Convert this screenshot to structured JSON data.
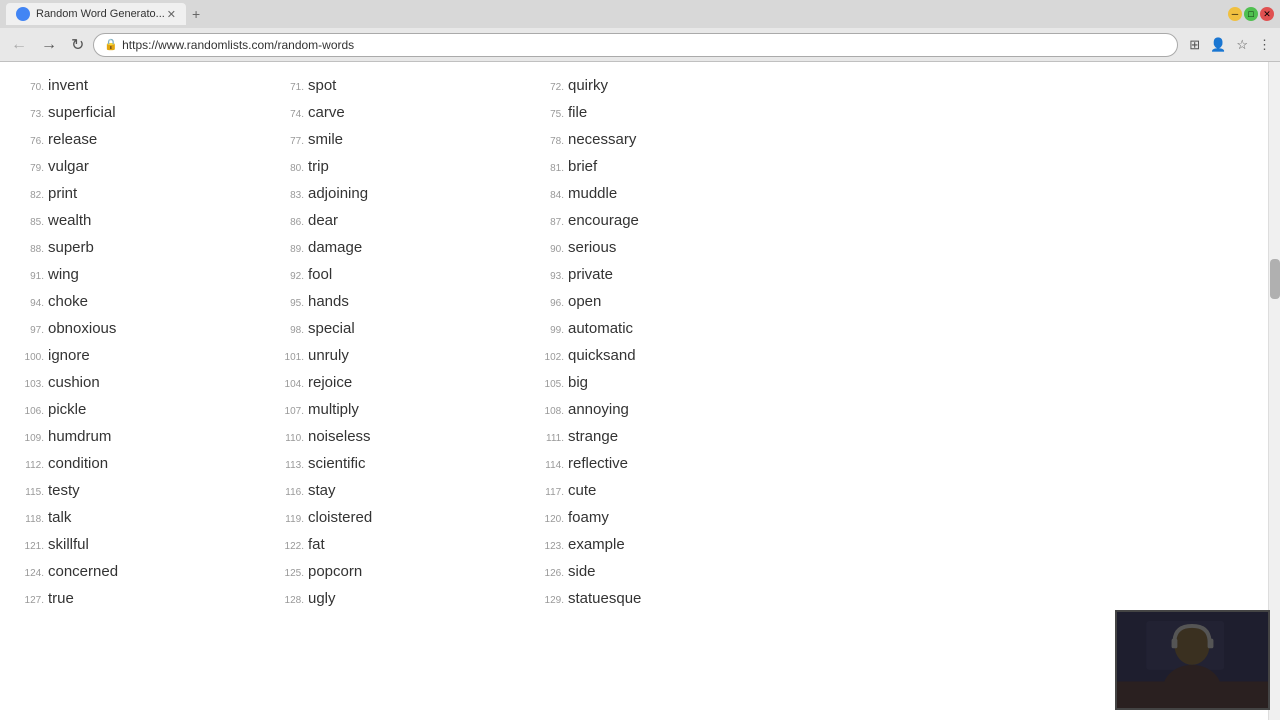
{
  "browser": {
    "tab_title": "Random Word Generato...",
    "url": "https://www.randomlists.com/random-words",
    "favicon": "🔀"
  },
  "words": [
    {
      "num": "70.",
      "word": "invent"
    },
    {
      "num": "71.",
      "word": "spot"
    },
    {
      "num": "72.",
      "word": "quirky"
    },
    {
      "num": "73.",
      "word": "superficial"
    },
    {
      "num": "74.",
      "word": "carve"
    },
    {
      "num": "75.",
      "word": "file"
    },
    {
      "num": "76.",
      "word": "release"
    },
    {
      "num": "77.",
      "word": "smile"
    },
    {
      "num": "78.",
      "word": "necessary"
    },
    {
      "num": "79.",
      "word": "vulgar"
    },
    {
      "num": "80.",
      "word": "trip"
    },
    {
      "num": "81.",
      "word": "brief"
    },
    {
      "num": "82.",
      "word": "print"
    },
    {
      "num": "83.",
      "word": "adjoining"
    },
    {
      "num": "84.",
      "word": "muddle"
    },
    {
      "num": "85.",
      "word": "wealth"
    },
    {
      "num": "86.",
      "word": "dear"
    },
    {
      "num": "87.",
      "word": "encourage"
    },
    {
      "num": "88.",
      "word": "superb"
    },
    {
      "num": "89.",
      "word": "damage"
    },
    {
      "num": "90.",
      "word": "serious"
    },
    {
      "num": "91.",
      "word": "wing"
    },
    {
      "num": "92.",
      "word": "fool"
    },
    {
      "num": "93.",
      "word": "private"
    },
    {
      "num": "94.",
      "word": "choke"
    },
    {
      "num": "95.",
      "word": "hands"
    },
    {
      "num": "96.",
      "word": "open"
    },
    {
      "num": "97.",
      "word": "obnoxious"
    },
    {
      "num": "98.",
      "word": "special"
    },
    {
      "num": "99.",
      "word": "automatic"
    },
    {
      "num": "100.",
      "word": "ignore"
    },
    {
      "num": "101.",
      "word": "unruly"
    },
    {
      "num": "102.",
      "word": "quicksand"
    },
    {
      "num": "103.",
      "word": "cushion"
    },
    {
      "num": "104.",
      "word": "rejoice"
    },
    {
      "num": "105.",
      "word": "big"
    },
    {
      "num": "106.",
      "word": "pickle"
    },
    {
      "num": "107.",
      "word": "multiply"
    },
    {
      "num": "108.",
      "word": "annoying"
    },
    {
      "num": "109.",
      "word": "humdrum"
    },
    {
      "num": "110.",
      "word": "noiseless"
    },
    {
      "num": "111.",
      "word": "strange"
    },
    {
      "num": "112.",
      "word": "condition"
    },
    {
      "num": "113.",
      "word": "scientific"
    },
    {
      "num": "114.",
      "word": "reflective"
    },
    {
      "num": "115.",
      "word": "testy"
    },
    {
      "num": "116.",
      "word": "stay"
    },
    {
      "num": "117.",
      "word": "cute"
    },
    {
      "num": "118.",
      "word": "talk"
    },
    {
      "num": "119.",
      "word": "cloistered"
    },
    {
      "num": "120.",
      "word": "foamy"
    },
    {
      "num": "121.",
      "word": "skillful"
    },
    {
      "num": "122.",
      "word": "fat"
    },
    {
      "num": "123.",
      "word": "example"
    },
    {
      "num": "124.",
      "word": "concerned"
    },
    {
      "num": "125.",
      "word": "popcorn"
    },
    {
      "num": "126.",
      "word": "side"
    },
    {
      "num": "127.",
      "word": "true"
    },
    {
      "num": "128.",
      "word": "ugly"
    },
    {
      "num": "129.",
      "word": "statuesque"
    }
  ]
}
